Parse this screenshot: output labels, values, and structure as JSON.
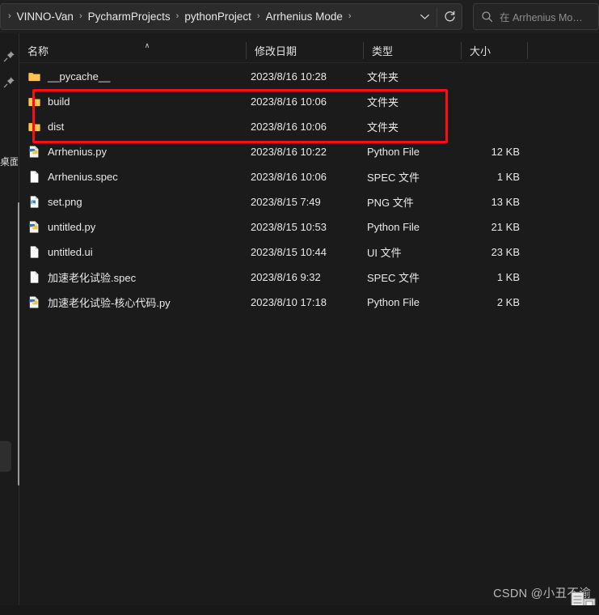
{
  "window": {
    "background_color": "#1b1b1b",
    "accent_color": "#fb0d11"
  },
  "addressbar": {
    "leading_separator": "›",
    "crumbs": [
      {
        "label": "VINNO-Van"
      },
      {
        "label": "PycharmProjects"
      },
      {
        "label": "pythonProject"
      },
      {
        "label": "Arrhenius Mode"
      }
    ],
    "separator": "›",
    "dropdown_icon": "chevron-down-icon",
    "refresh_icon": "refresh-icon"
  },
  "search": {
    "icon": "search-icon",
    "placeholder": "在 Arrhenius Mo…"
  },
  "sidebar": {
    "pins": [
      {
        "icon": "pin-icon"
      },
      {
        "icon": "pin-icon"
      }
    ],
    "clipped_label": "桌面"
  },
  "columns": [
    {
      "key": "name",
      "label": "名称",
      "sorted": true,
      "sort_direction": "ascending"
    },
    {
      "key": "date",
      "label": "修改日期",
      "sorted": false
    },
    {
      "key": "type",
      "label": "类型",
      "sorted": false
    },
    {
      "key": "size",
      "label": "大小",
      "sorted": false
    }
  ],
  "sort_caret": "∧",
  "files": [
    {
      "name": "__pycache__",
      "date": "2023/8/16 10:28",
      "type": "文件夹",
      "size": "",
      "icon": "folder-icon"
    },
    {
      "name": "build",
      "date": "2023/8/16 10:06",
      "type": "文件夹",
      "size": "",
      "icon": "folder-icon"
    },
    {
      "name": "dist",
      "date": "2023/8/16 10:06",
      "type": "文件夹",
      "size": "",
      "icon": "folder-icon"
    },
    {
      "name": "Arrhenius.py",
      "date": "2023/8/16 10:22",
      "type": "Python File",
      "size": "12 KB",
      "icon": "python-file-icon"
    },
    {
      "name": "Arrhenius.spec",
      "date": "2023/8/16 10:06",
      "type": "SPEC 文件",
      "size": "1 KB",
      "icon": "document-icon"
    },
    {
      "name": "set.png",
      "date": "2023/8/15 7:49",
      "type": "PNG 文件",
      "size": "13 KB",
      "icon": "image-file-icon"
    },
    {
      "name": "untitled.py",
      "date": "2023/8/15 10:53",
      "type": "Python File",
      "size": "21 KB",
      "icon": "python-file-icon"
    },
    {
      "name": "untitled.ui",
      "date": "2023/8/15 10:44",
      "type": "UI 文件",
      "size": "23 KB",
      "icon": "document-icon"
    },
    {
      "name": "加速老化试验.spec",
      "date": "2023/8/16 9:32",
      "type": "SPEC 文件",
      "size": "1 KB",
      "icon": "document-icon"
    },
    {
      "name": "加速老化试验-核心代码.py",
      "date": "2023/8/10 17:18",
      "type": "Python File",
      "size": "2 KB",
      "icon": "python-file-icon"
    }
  ],
  "annotation": {
    "color": "#fb0d11",
    "targets": [
      "build",
      "dist"
    ]
  },
  "watermark": {
    "text": "CSDN @小丑不谕"
  }
}
